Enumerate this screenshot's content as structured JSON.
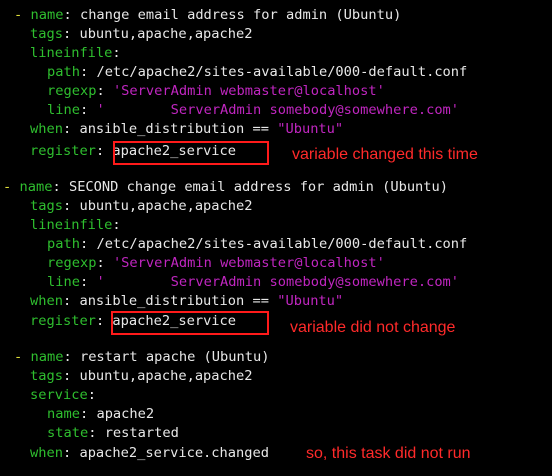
{
  "colors": {
    "background": "#000000",
    "dash": "#dede3a",
    "key": "#2fbf2f",
    "string": "#c026c0",
    "text": "#e8e8e8",
    "annotation": "#ff1a1a"
  },
  "tasks": [
    {
      "name": "change email address for admin (Ubuntu)",
      "tags": "ubuntu,apache,apache2",
      "lineinfile": {
        "path": "/etc/apache2/sites-available/000-default.conf",
        "regexp": "'ServerAdmin webmaster@localhost'",
        "line": "'        ServerAdmin somebody@somewhere.com'"
      },
      "when_pre": "ansible_distribution == ",
      "when_str": "\"Ubuntu\"",
      "register": "apache2_service",
      "annotation": "variable changed this time"
    },
    {
      "name": "SECOND change email address for admin (Ubuntu)",
      "tags": "ubuntu,apache,apache2",
      "lineinfile": {
        "path": "/etc/apache2/sites-available/000-default.conf",
        "regexp": "'ServerAdmin webmaster@localhost'",
        "line": "'        ServerAdmin somebody@somewhere.com'"
      },
      "when_pre": "ansible_distribution == ",
      "when_str": "\"Ubuntu\"",
      "register": "apache2_service",
      "annotation": "variable did not change"
    },
    {
      "name": "restart apache (Ubuntu)",
      "tags": "ubuntu,apache,apache2",
      "service": {
        "name": "apache2",
        "state": "restarted"
      },
      "when": "apache2_service.changed",
      "annotation": "so, this task did not run"
    }
  ],
  "keys": {
    "dash": "-",
    "name": "name",
    "tags": "tags",
    "lineinfile": "lineinfile",
    "path": "path",
    "regexp": "regexp",
    "line": "line",
    "when": "when",
    "register": "register",
    "service": "service",
    "state": "state",
    "colon": ":",
    "colon_sp": ": "
  }
}
